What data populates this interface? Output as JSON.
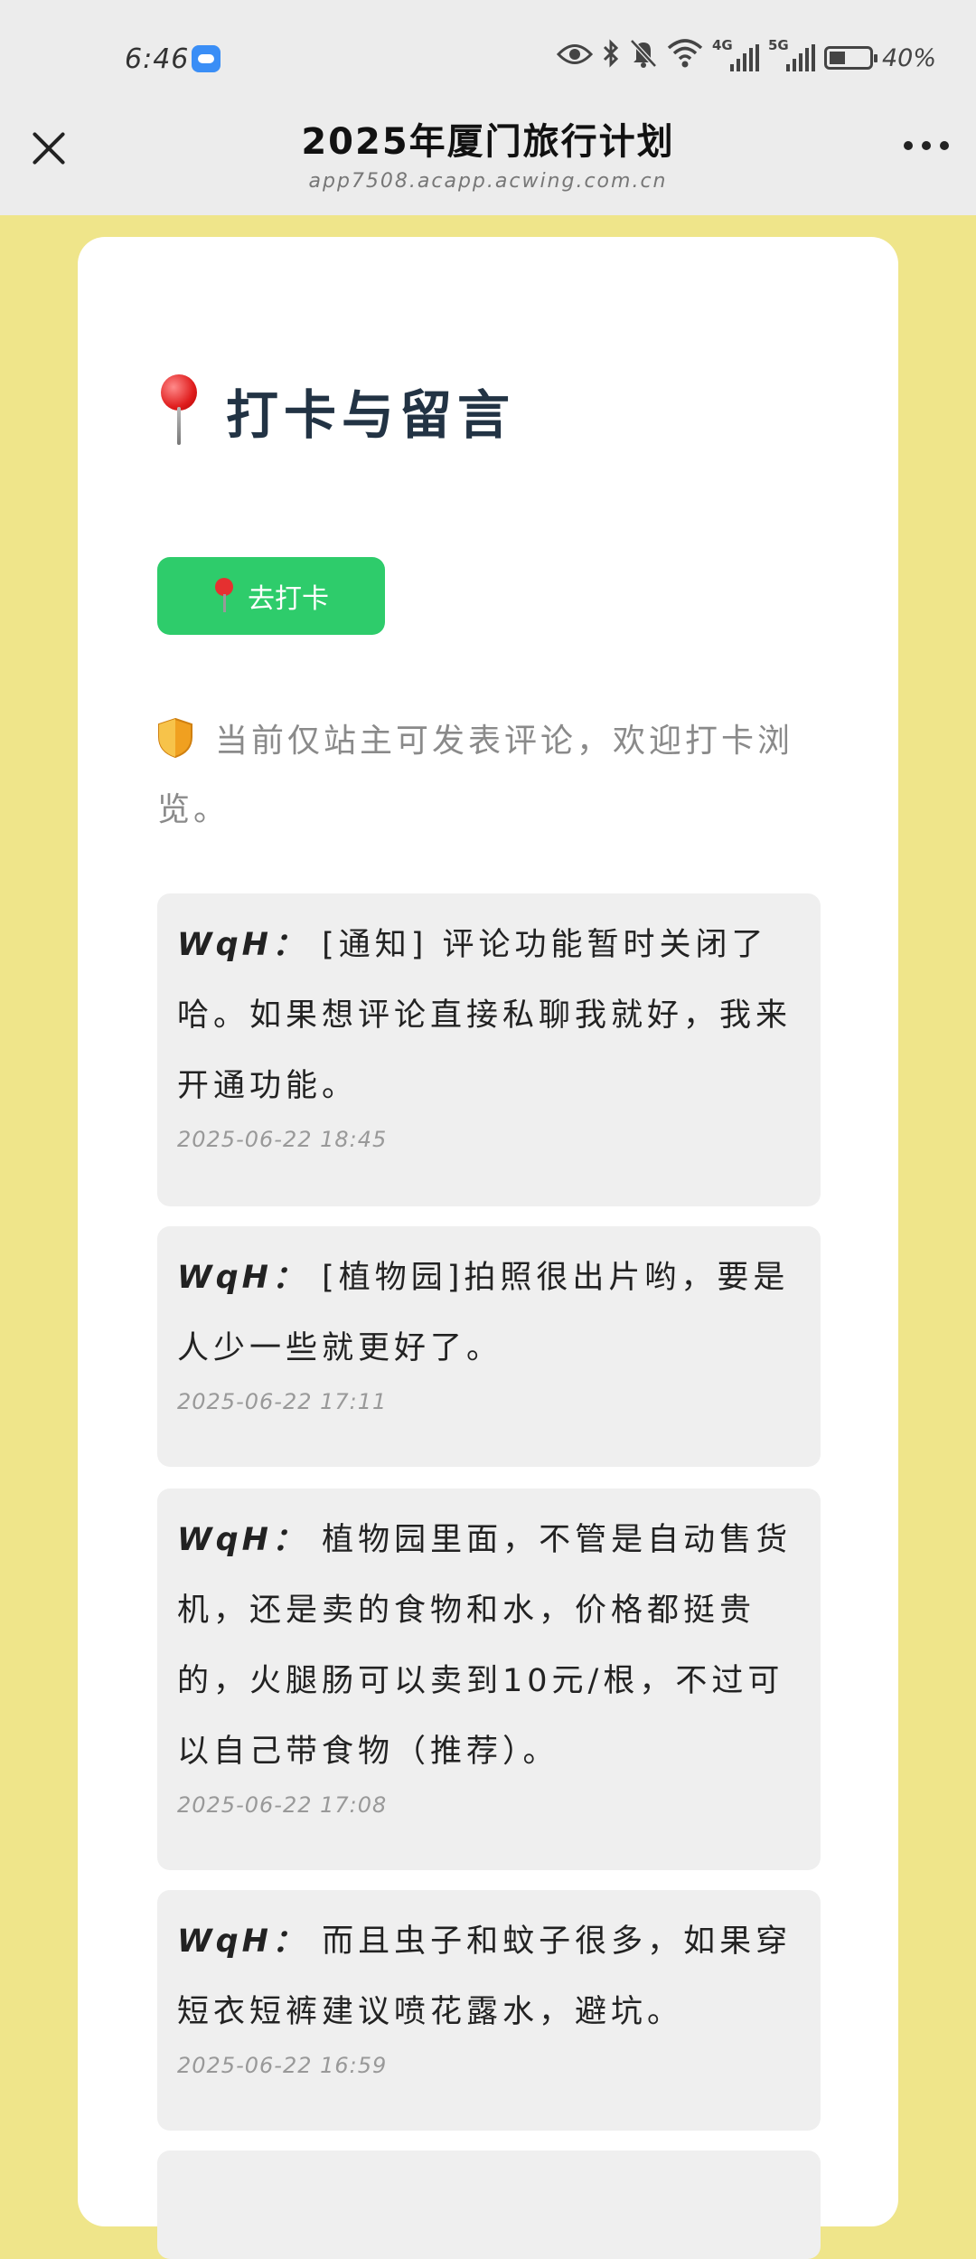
{
  "status_bar": {
    "time": "6:46",
    "net1": "4G",
    "net2": "5G",
    "battery_level": 0.4,
    "battery_text": "40%"
  },
  "title_bar": {
    "title": "2025年厦门旅行计划",
    "subtitle": "app7508.acapp.acwing.com.cn"
  },
  "page": {
    "heading": "打卡与留言",
    "checkin_button": "去打卡",
    "notice": "当前仅站主可发表评论，欢迎打卡浏览。"
  },
  "comments": [
    {
      "author": "WqH：",
      "text": "[通知] 评论功能暂时关闭了哈。如果想评论直接私聊我就好，我来开通功能。",
      "time": "2025-06-22 18:45"
    },
    {
      "author": "WqH：",
      "text": "[植物园]拍照很出片哟，要是人少一些就更好了。",
      "time": "2025-06-22 17:11"
    },
    {
      "author": "WqH：",
      "text": "植物园里面，不管是自动售货机，还是卖的食物和水，价格都挺贵的，火腿肠可以卖到10元/根，不过可以自己带食物（推荐）。",
      "time": "2025-06-22 17:08"
    },
    {
      "author": "WqH：",
      "text": "而且虫子和蚊子很多，如果穿短衣短裤建议喷花露水，避坑。",
      "time": "2025-06-22 16:59"
    }
  ]
}
